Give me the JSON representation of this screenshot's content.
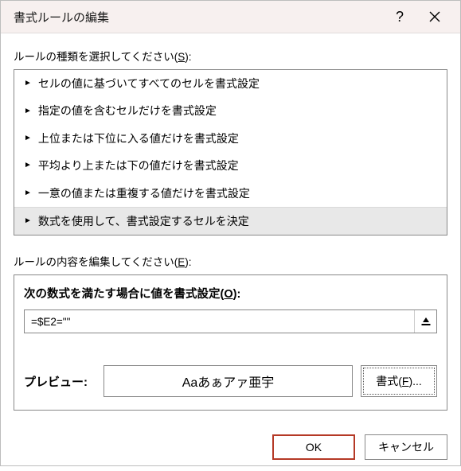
{
  "title": "書式ルールの編集",
  "section_select_label_pre": "ルールの種類を選択してください(",
  "section_select_label_accel": "S",
  "section_select_label_post": "):",
  "rules": [
    {
      "label": "セルの値に基づいてすべてのセルを書式設定",
      "selected": false
    },
    {
      "label": "指定の値を含むセルだけを書式設定",
      "selected": false
    },
    {
      "label": "上位または下位に入る値だけを書式設定",
      "selected": false
    },
    {
      "label": "平均より上または下の値だけを書式設定",
      "selected": false
    },
    {
      "label": "一意の値または重複する値だけを書式設定",
      "selected": false
    },
    {
      "label": "数式を使用して、書式設定するセルを決定",
      "selected": true
    }
  ],
  "section_edit_label_pre": "ルールの内容を編集してください(",
  "section_edit_label_accel": "E",
  "section_edit_label_post": "):",
  "edit_heading_pre": "次の数式を満たす場合に値を書式設定(",
  "edit_heading_accel": "O",
  "edit_heading_post": "):",
  "formula_value": "=$E2=\"\"",
  "preview_label": "プレビュー:",
  "preview_text": "Aaあぁアァ亜宇",
  "format_btn_pre": "書式(",
  "format_btn_accel": "F",
  "format_btn_post": ")...",
  "ok_label": "OK",
  "cancel_label": "キャンセル"
}
